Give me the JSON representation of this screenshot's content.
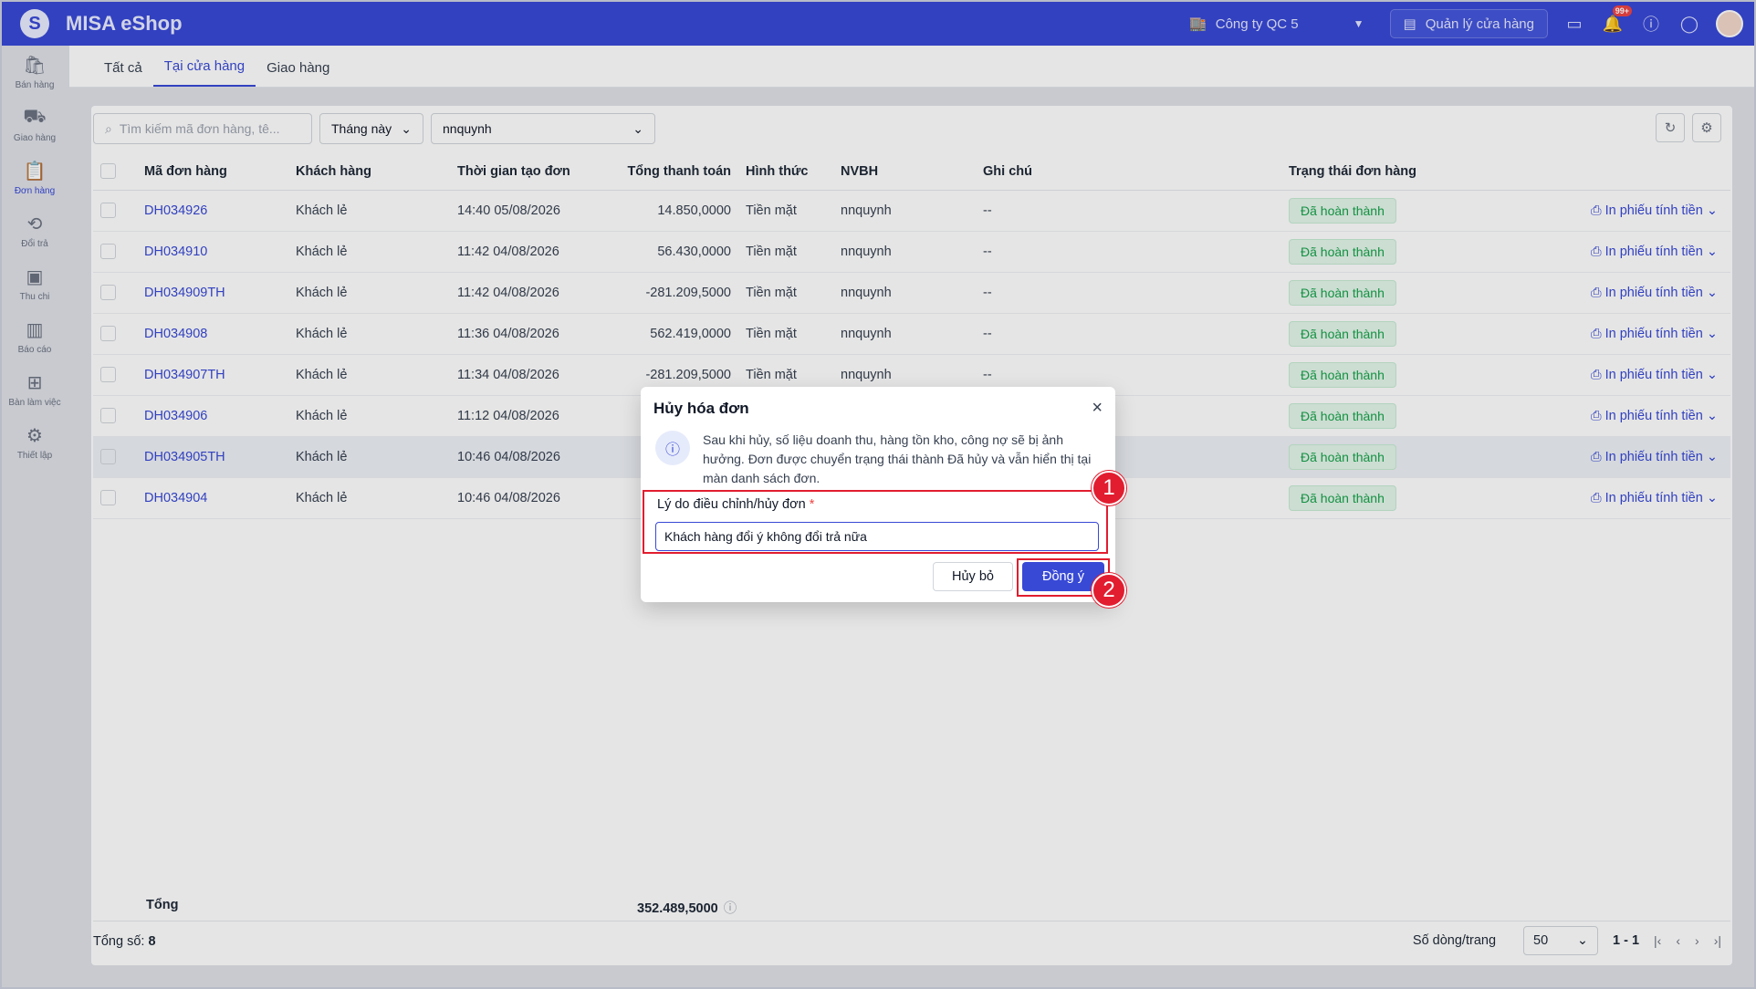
{
  "app": {
    "logo_text": "S",
    "title": "MISA eShop"
  },
  "topbar": {
    "company": "Công ty QC 5",
    "store_button": "Quản lý cửa hàng",
    "notification_badge": "99+",
    "icons": [
      "screen-icon",
      "bell-icon",
      "help-icon",
      "chat-icon",
      "avatar"
    ]
  },
  "sidebar": {
    "items": [
      {
        "label": "Bán hàng",
        "icon": "shopping-bag-icon",
        "glyph": "🛍"
      },
      {
        "label": "Giao hàng",
        "icon": "truck-icon",
        "glyph": "⛟"
      },
      {
        "label": "Đơn hàng",
        "icon": "clipboard-icon",
        "glyph": "📋",
        "active": true
      },
      {
        "label": "Đổi trả",
        "icon": "box-return-icon",
        "glyph": "⟲"
      },
      {
        "label": "Thu chi",
        "icon": "wallet-icon",
        "glyph": "▣"
      },
      {
        "label": "Báo cáo",
        "icon": "chart-icon",
        "glyph": "▥"
      },
      {
        "label": "Bàn làm việc",
        "icon": "grid-icon",
        "glyph": "⊞"
      },
      {
        "label": "Thiết lập",
        "icon": "gear-icon",
        "glyph": "⚙"
      }
    ]
  },
  "tabs": [
    {
      "label": "Tất cả"
    },
    {
      "label": "Tại cửa hàng",
      "active": true
    },
    {
      "label": "Giao hàng"
    }
  ],
  "filters": {
    "search_placeholder": "Tìm kiếm mã đơn hàng, tê...",
    "period": "Tháng này",
    "user": "nnquynh"
  },
  "table": {
    "columns": [
      "Mã đơn hàng",
      "Khách hàng",
      "Thời gian tạo đơn",
      "Tổng thanh toán",
      "Hình thức",
      "NVBH",
      "Ghi chú",
      "Trạng thái đơn hàng"
    ],
    "rows": [
      {
        "code": "DH034926",
        "customer": "Khách lẻ",
        "time": "14:40 05/08/2026",
        "total": "14.850,0000",
        "method": "Tiền mặt",
        "staff": "nnquynh",
        "note": "--",
        "status": "Đã hoàn thành",
        "action": "In phiếu tính tiền"
      },
      {
        "code": "DH034910",
        "customer": "Khách lẻ",
        "time": "11:42 04/08/2026",
        "total": "56.430,0000",
        "method": "Tiền mặt",
        "staff": "nnquynh",
        "note": "--",
        "status": "Đã hoàn thành",
        "action": "In phiếu tính tiền"
      },
      {
        "code": "DH034909TH",
        "customer": "Khách lẻ",
        "time": "11:42 04/08/2026",
        "total": "-281.209,5000",
        "method": "Tiền mặt",
        "staff": "nnquynh",
        "note": "--",
        "status": "Đã hoàn thành",
        "action": "In phiếu tính tiền"
      },
      {
        "code": "DH034908",
        "customer": "Khách lẻ",
        "time": "11:36 04/08/2026",
        "total": "562.419,0000",
        "method": "Tiền mặt",
        "staff": "nnquynh",
        "note": "--",
        "status": "Đã hoàn thành",
        "action": "In phiếu tính tiền"
      },
      {
        "code": "DH034907TH",
        "customer": "Khách lẻ",
        "time": "11:34 04/08/2026",
        "total": "-281.209,5000",
        "method": "Tiền mặt",
        "staff": "nnquynh",
        "note": "--",
        "status": "Đã hoàn thành",
        "action": "In phiếu tính tiền"
      },
      {
        "code": "DH034906",
        "customer": "Khách lẻ",
        "time": "11:12 04/08/2026",
        "total": "",
        "method": "",
        "staff": "",
        "note": "",
        "status": "Đã hoàn thành",
        "action": "In phiếu tính tiền"
      },
      {
        "code": "DH034905TH",
        "customer": "Khách lẻ",
        "time": "10:46 04/08/2026",
        "total": "",
        "method": "",
        "staff": "",
        "note": "",
        "status": "Đã hoàn thành",
        "action": "In phiếu tính tiền",
        "highlighted": true
      },
      {
        "code": "DH034904",
        "customer": "Khách lẻ",
        "time": "10:46 04/08/2026",
        "total": "",
        "method": "",
        "staff": "",
        "note": "",
        "status": "Đã hoàn thành",
        "action": "In phiếu tính tiền"
      }
    ]
  },
  "summary": {
    "label": "Tổng",
    "value": "352.489,5000"
  },
  "pager": {
    "total_label": "Tổng số:",
    "total_count": "8",
    "rows_label": "Số dòng/trang",
    "page_size": "50",
    "range": "1 - 1"
  },
  "modal": {
    "title": "Hủy hóa đơn",
    "info": "Sau khi hủy, số liệu doanh thu, hàng tồn kho, công nợ sẽ bị ảnh hưởng. Đơn được chuyển trạng thái thành Đã hủy và vẫn hiển thị tại màn danh sách đơn.",
    "field_label": "Lý do điều chỉnh/hủy đơn",
    "required_mark": "*",
    "field_value": "Khách hàng đổi ý không đổi trả nữa",
    "cancel_label": "Hủy bỏ",
    "ok_label": "Đồng ý"
  },
  "annotations": [
    "1",
    "2"
  ],
  "colors": {
    "primary": "#3849d6",
    "success": "#16a34a",
    "annotation": "#e11d2f"
  }
}
